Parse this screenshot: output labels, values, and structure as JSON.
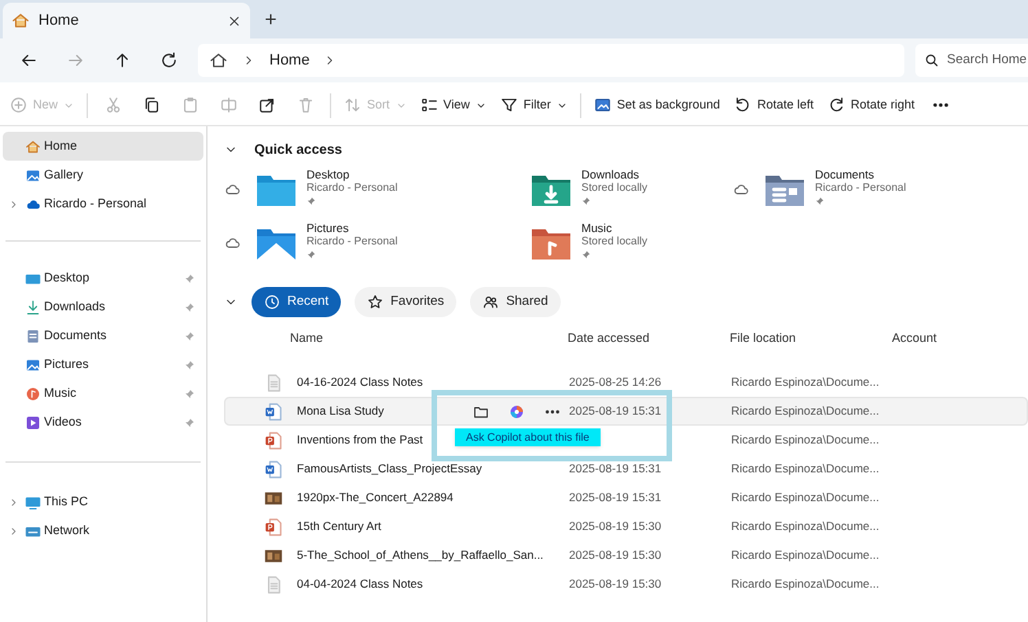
{
  "tabs": [
    {
      "label": "Home",
      "selected": true
    }
  ],
  "new_tab": "+",
  "address": {
    "breadcrumb": [
      "Home"
    ],
    "search_placeholder": "Search Home"
  },
  "toolbar": [
    {
      "label": "New",
      "disabled": true,
      "menu": true
    },
    {
      "disabled": true
    },
    {
      "disabled": false
    },
    {
      "disabled": true
    },
    {
      "disabled": true
    },
    {
      "disabled": false
    },
    {
      "disabled": true
    },
    {
      "label": "Sort",
      "disabled": true,
      "menu": true
    },
    {
      "label": "View",
      "disabled": false,
      "menu": true
    },
    {
      "label": "Filter",
      "disabled": false,
      "menu": true
    },
    {
      "label": "Set as background",
      "disabled": false,
      "menu": false
    },
    {
      "label": "Rotate left",
      "disabled": false,
      "menu": false
    },
    {
      "label": "Rotate right",
      "disabled": false,
      "menu": false
    },
    {
      "disabled": false
    }
  ],
  "sidebar": {
    "groups": [
      [
        {
          "label": "Home",
          "selected": true,
          "expandable": false,
          "pinned": false
        },
        {
          "label": "Gallery",
          "selected": false,
          "expandable": false,
          "pinned": false
        },
        {
          "label": "Ricardo - Personal",
          "selected": false,
          "expandable": true,
          "pinned": false
        }
      ],
      [
        {
          "label": "Desktop",
          "selected": false,
          "expandable": false,
          "pinned": true
        },
        {
          "label": "Downloads",
          "selected": false,
          "expandable": false,
          "pinned": true
        },
        {
          "label": "Documents",
          "selected": false,
          "expandable": false,
          "pinned": true
        },
        {
          "label": "Pictures",
          "selected": false,
          "expandable": false,
          "pinned": true
        },
        {
          "label": "Music",
          "selected": false,
          "expandable": false,
          "pinned": true
        },
        {
          "label": "Videos",
          "selected": false,
          "expandable": false,
          "pinned": true
        }
      ],
      [
        {
          "label": "This PC",
          "selected": false,
          "expandable": true,
          "pinned": false
        },
        {
          "label": "Network",
          "selected": false,
          "expandable": true,
          "pinned": false
        }
      ]
    ]
  },
  "quick_access": {
    "title": "Quick access",
    "expanded": true,
    "items": [
      {
        "name": "Desktop",
        "detail": "Ricardo - Personal",
        "cloud": true
      },
      {
        "name": "Downloads",
        "detail": "Stored locally",
        "cloud": false
      },
      {
        "name": "Documents",
        "detail": "Ricardo - Personal",
        "cloud": true
      },
      {
        "name": "Pictures",
        "detail": "Ricardo - Personal",
        "cloud": true
      },
      {
        "name": "Music",
        "detail": "Stored locally",
        "cloud": false
      }
    ]
  },
  "recent": {
    "expanded": true,
    "filters": [
      {
        "label": "Recent",
        "selected": true
      },
      {
        "label": "Favorites",
        "selected": false
      },
      {
        "label": "Shared",
        "selected": false
      }
    ],
    "columns": [
      "Name",
      "Date accessed",
      "File location",
      "Account"
    ],
    "rows": [
      {
        "kind": "text",
        "name": "04-16-2024 Class Notes",
        "date": "2025-08-25 14:26",
        "location": "Ricardo Espinoza\\Docume...",
        "selected": false
      },
      {
        "kind": "word",
        "name": "Mona Lisa Study",
        "date": "2025-08-19 15:31",
        "location": "Ricardo Espinoza\\Docume...",
        "selected": true
      },
      {
        "kind": "slides",
        "name": "Inventions from the Past",
        "location": "Ricardo Espinoza\\Docume...",
        "selected": false
      },
      {
        "kind": "word",
        "name": "FamousArtists_Class_ProjectEssay",
        "date": "2025-08-19 15:31",
        "location": "Ricardo Espinoza\\Docume...",
        "selected": false
      },
      {
        "kind": "image",
        "name": "1920px-The_Concert_A22894",
        "date": "2025-08-19 15:31",
        "location": "Ricardo Espinoza\\Docume...",
        "selected": false
      },
      {
        "kind": "slides",
        "name": "15th Century Art",
        "date": "2025-08-19 15:30",
        "location": "Ricardo Espinoza\\Docume...",
        "selected": false
      },
      {
        "kind": "image",
        "name": "5-The_School_of_Athens__by_Raffaello_San...",
        "date": "2025-08-19 15:30",
        "location": "Ricardo Espinoza\\Docume...",
        "selected": false
      },
      {
        "kind": "text",
        "name": "04-04-2024 Class Notes",
        "date": "2025-08-19 15:30",
        "location": "Ricardo Espinoza\\Docume...",
        "selected": false
      }
    ],
    "tooltip": "Ask Copilot about this file"
  }
}
